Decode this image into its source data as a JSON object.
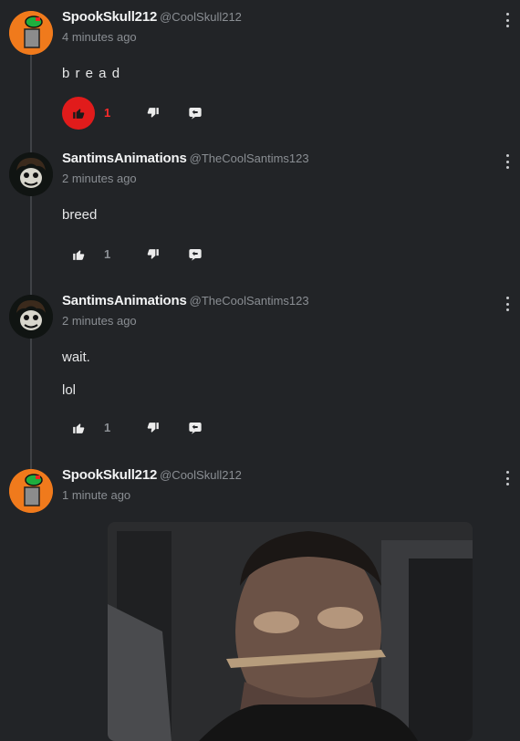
{
  "comments": [
    {
      "username": "SpookSkull212",
      "handle": "@CoolSkull212",
      "time": "4 minutes ago",
      "lines": [
        "b r e a d"
      ],
      "likes": "1"
    },
    {
      "username": "SantimsAnimations",
      "handle": "@TheCoolSantims123",
      "time": "2 minutes ago",
      "lines": [
        "breed"
      ],
      "likes": "1"
    },
    {
      "username": "SantimsAnimations",
      "handle": "@TheCoolSantims123",
      "time": "2 minutes ago",
      "lines": [
        "wait.",
        "lol"
      ],
      "likes": "1"
    },
    {
      "username": "SpookSkull212",
      "handle": "@CoolSkull212",
      "time": "1 minute ago"
    }
  ],
  "colors": {
    "background": "#222427",
    "liked": "#e11b1b",
    "muted": "#8a8e93"
  }
}
